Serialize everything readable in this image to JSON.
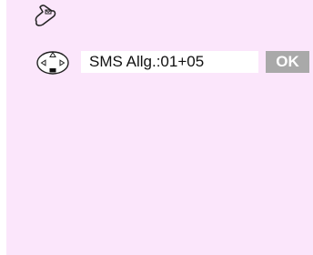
{
  "icons": {
    "message": "envelope-icon",
    "navigation": "nav-key-icon"
  },
  "sms_line": {
    "text": "SMS Allg.:01+05"
  },
  "ok_button": {
    "label": "OK"
  },
  "colors": {
    "panel_background": "#fbe6fb",
    "button_background": "#a9a9a9",
    "button_text": "#ffffff"
  }
}
